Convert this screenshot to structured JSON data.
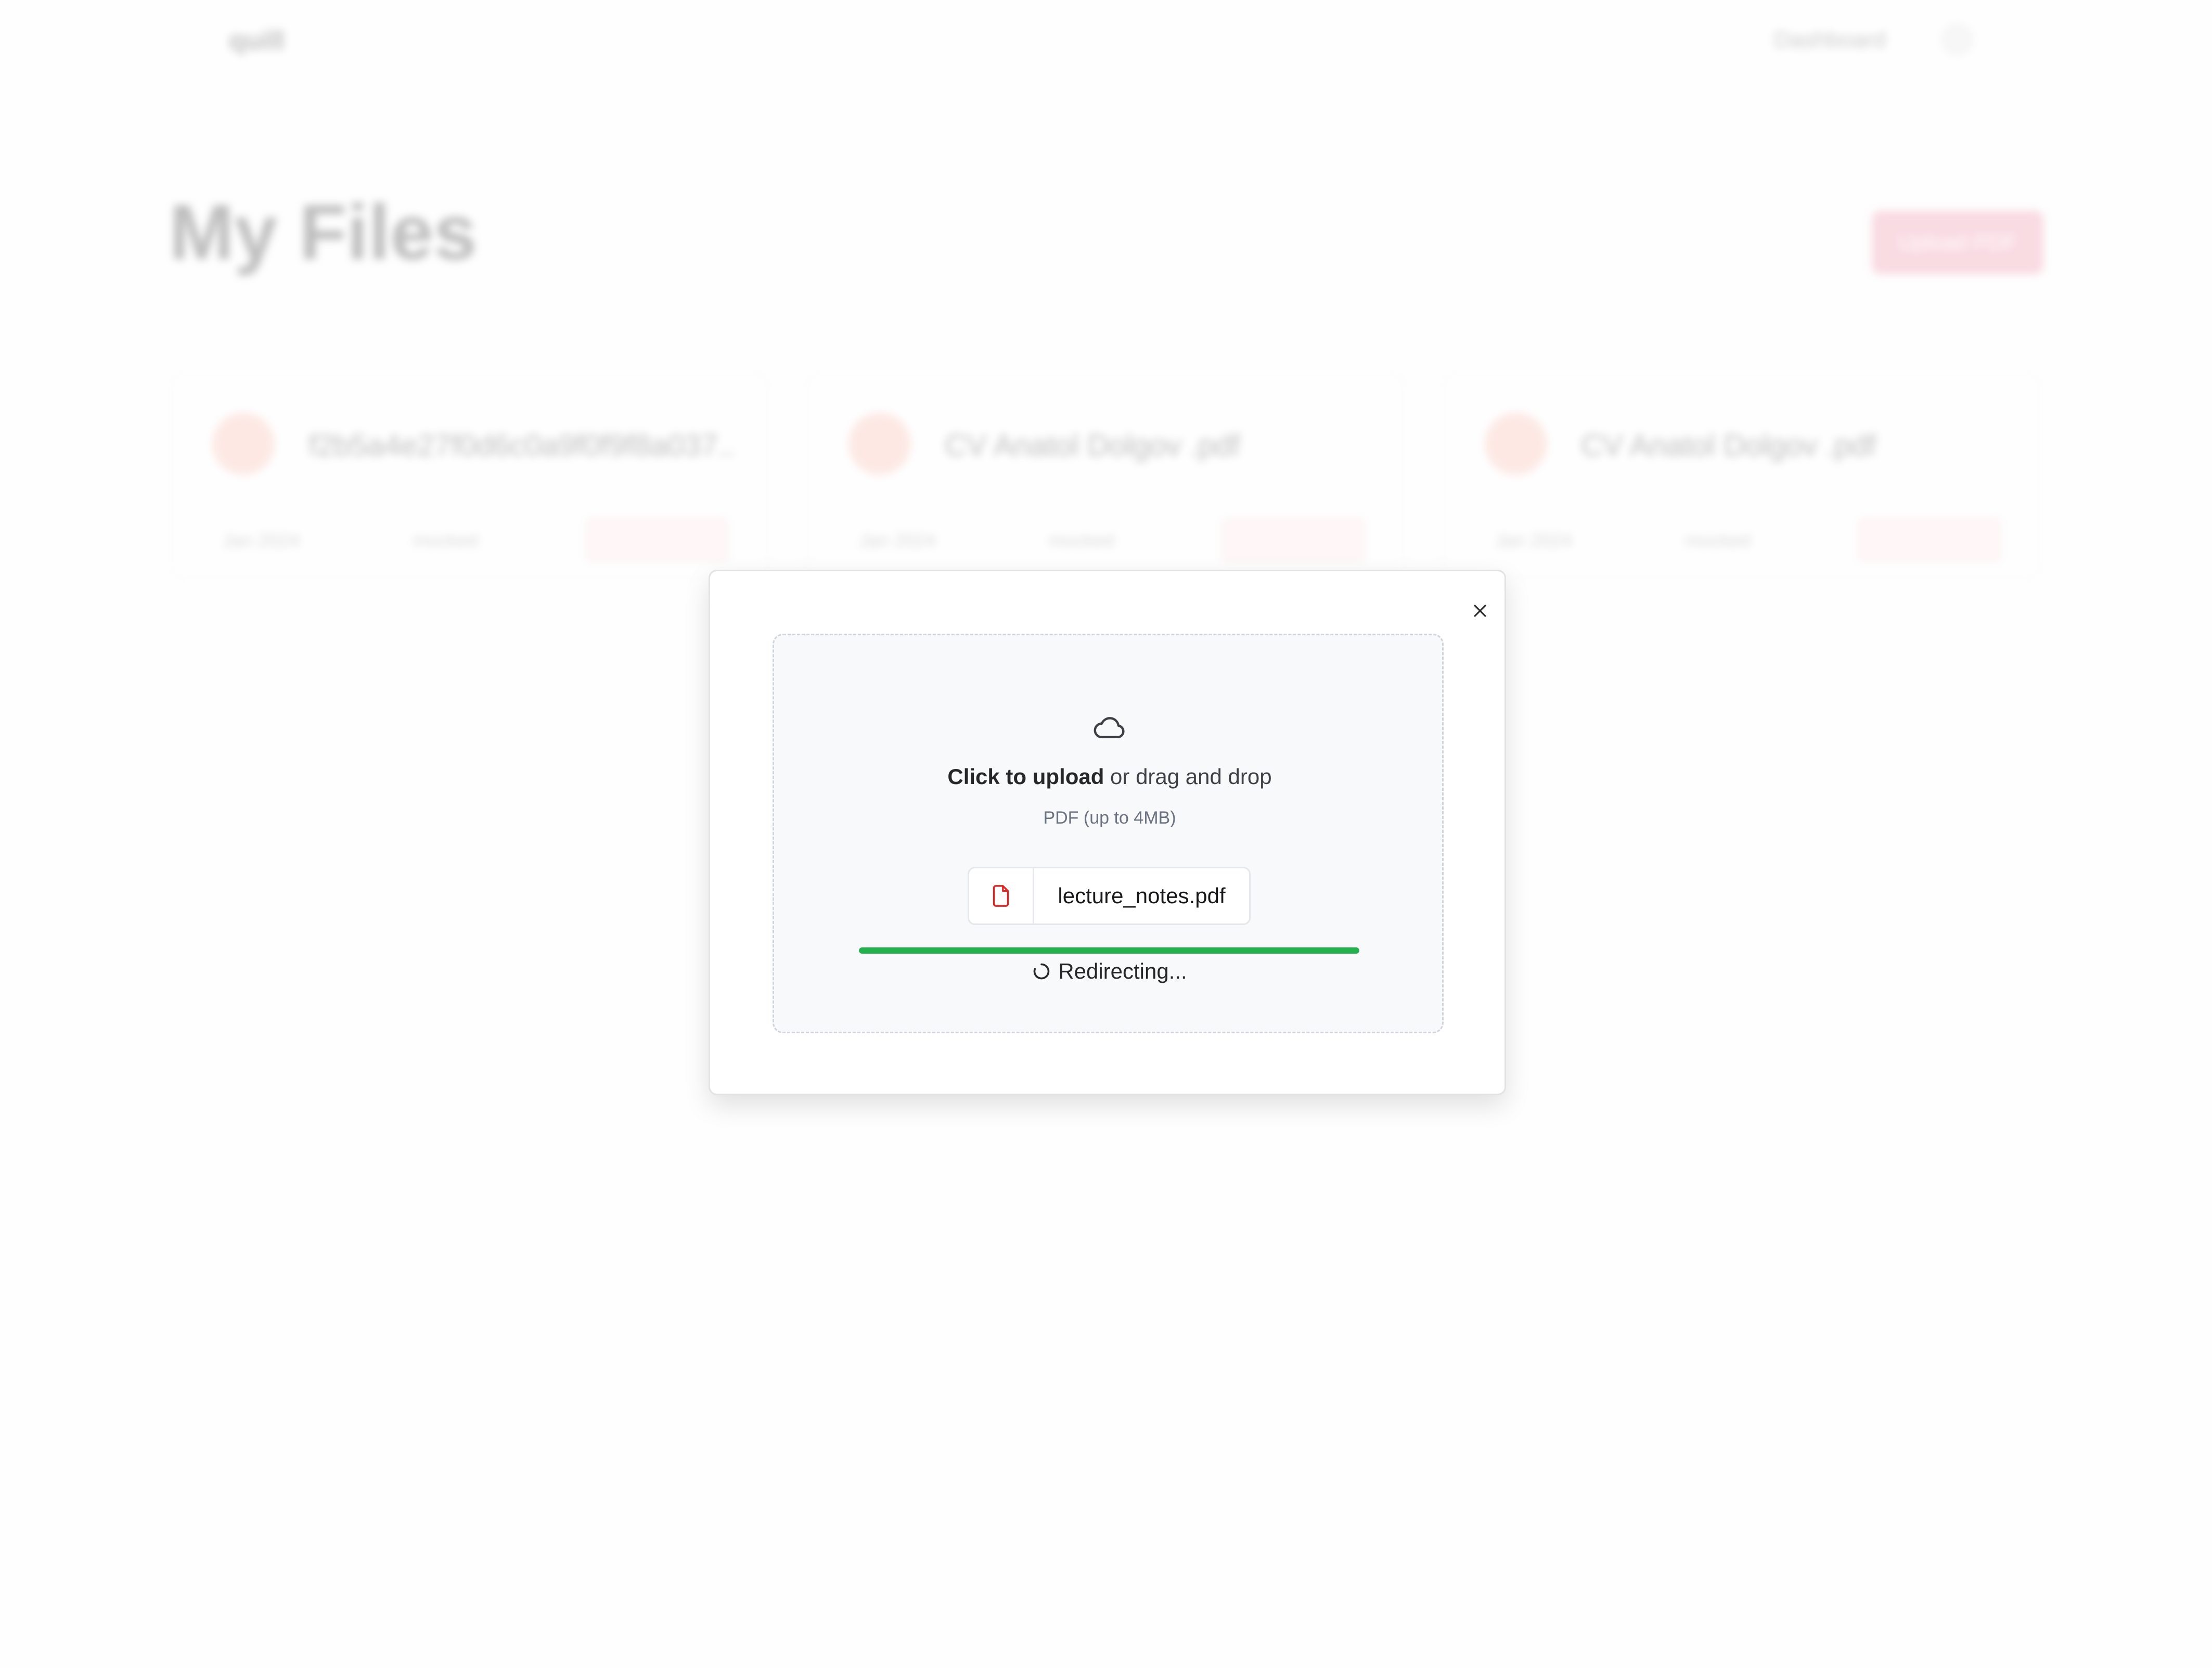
{
  "background_page": {
    "logo": "quill",
    "nav_link": "Dashboard",
    "page_title": "My Files",
    "upload_button": "Upload PDF",
    "files": [
      {
        "name": "f2b5a4e27f0d6c0a9f0f9f8a037...",
        "created": "Jan 2024",
        "messages": "mocked"
      },
      {
        "name": "CV Anatol Dolgov .pdf",
        "created": "Jan 2024",
        "messages": "mocked"
      },
      {
        "name": "CV Anatol Dolgov .pdf",
        "created": "Jan 2024",
        "messages": "mocked"
      }
    ]
  },
  "modal": {
    "dropzone": {
      "click_label": "Click to upload",
      "drag_label": " or drag and drop",
      "hint": "PDF (up to 4MB)"
    },
    "selected_file": {
      "name": "lecture_notes.pdf",
      "icon": "pdf-file-icon"
    },
    "progress": {
      "percent": 100,
      "color": "#22b14c"
    },
    "status_text": "Redirecting...",
    "icons": {
      "close": "close-icon",
      "upload": "cloud-icon",
      "spinner": "spinner-icon"
    }
  },
  "colors": {
    "accent_pink": "#ef8aa3",
    "pdf_red": "#dc2626",
    "success_green": "#22b14c"
  }
}
